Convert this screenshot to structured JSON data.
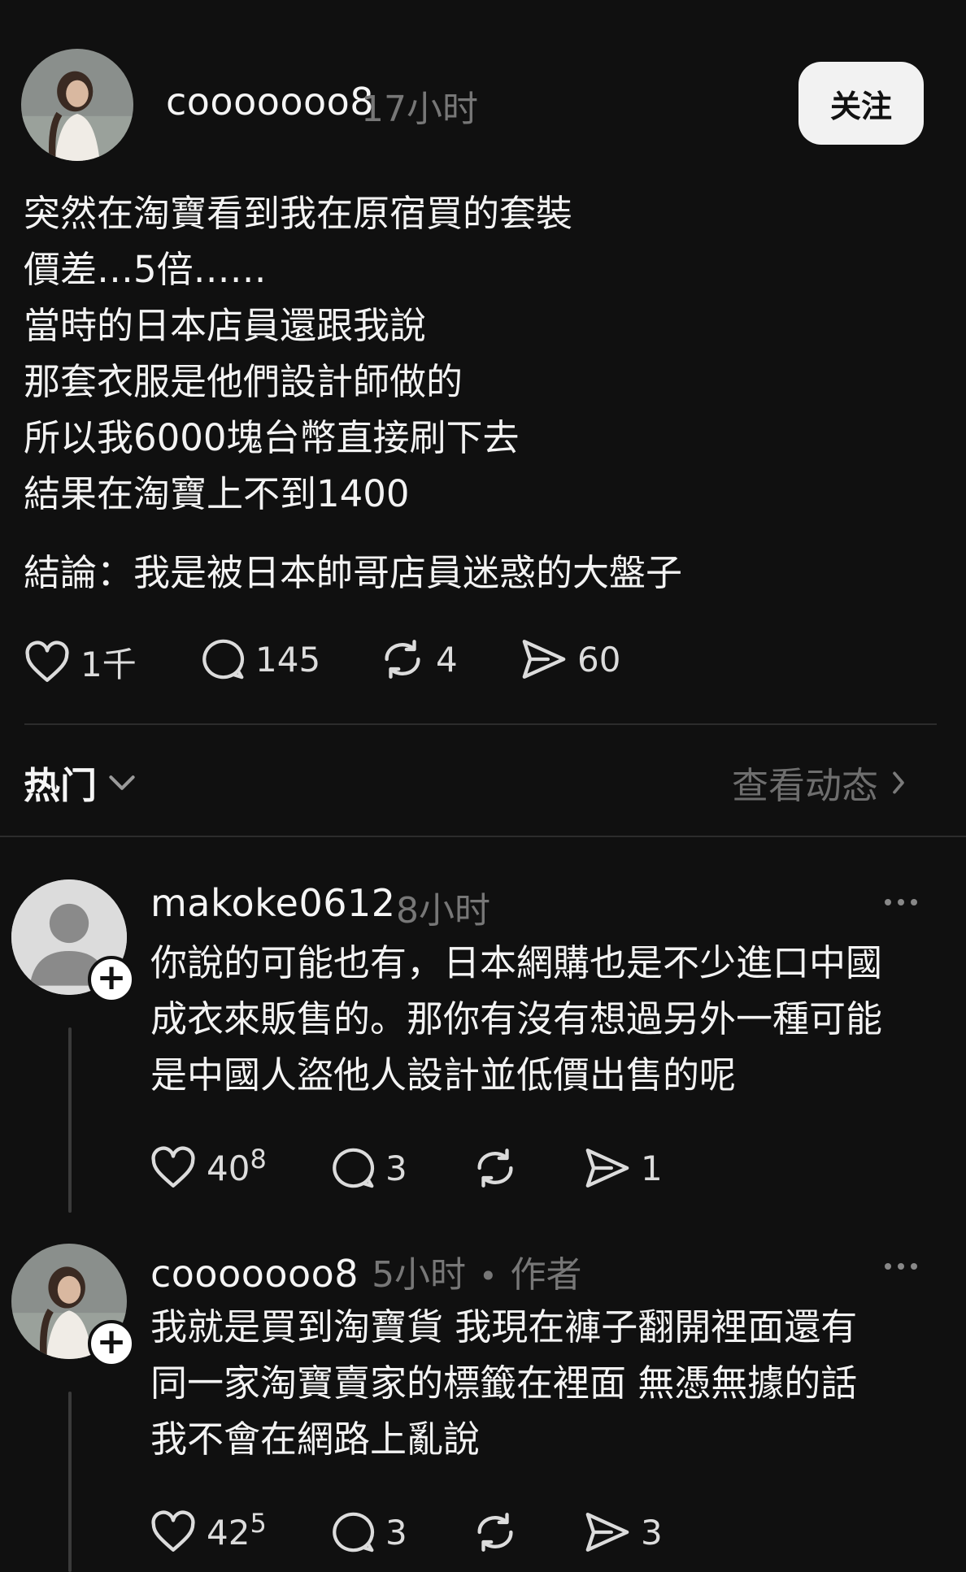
{
  "post": {
    "username": "cooooooo8",
    "time": "17小时",
    "follow_label": "关注",
    "lines": [
      "突然在淘寶看到我在原宿買的套裝",
      "價差…5倍……",
      "當時的日本店員還跟我說",
      "那套衣服是他們設計師做的",
      "所以我6000塊台幣直接刷下去",
      "結果在淘寶上不到1400"
    ],
    "conclusion": "結論：我是被日本帥哥店員迷惑的大盤子",
    "actions": {
      "likes": "1千",
      "comments": "145",
      "reposts": "4",
      "shares": "60"
    }
  },
  "replies_header": {
    "sort_label": "热门",
    "view_activity": "查看动态"
  },
  "replies": [
    {
      "username": "makoke0612",
      "time": "8小时",
      "author_tag": "",
      "lines": [
        "你說的可能也有，日本網購也是不少進口中國",
        "成衣來販售的。那你有沒有想過另外一種可能",
        "是中國人盜他人設計並低價出售的呢"
      ],
      "likes_main": "40",
      "likes_sup": "8",
      "comments": "3",
      "shares": "1"
    },
    {
      "username": "cooooooo8",
      "time": "5小时",
      "author_tag": "作者",
      "lines": [
        "我就是買到淘寶貨 我現在褲子翻開裡面還有",
        "同一家淘寶賣家的標籤在裡面 無憑無據的話",
        "我不會在網路上亂說"
      ],
      "likes_main": "42",
      "likes_sup": "5",
      "comments": "3",
      "shares": "3"
    }
  ],
  "colors": {
    "background": "#101010",
    "text": "#f3f3f3",
    "muted": "#777777",
    "follow_bg": "#f2f2f2"
  }
}
